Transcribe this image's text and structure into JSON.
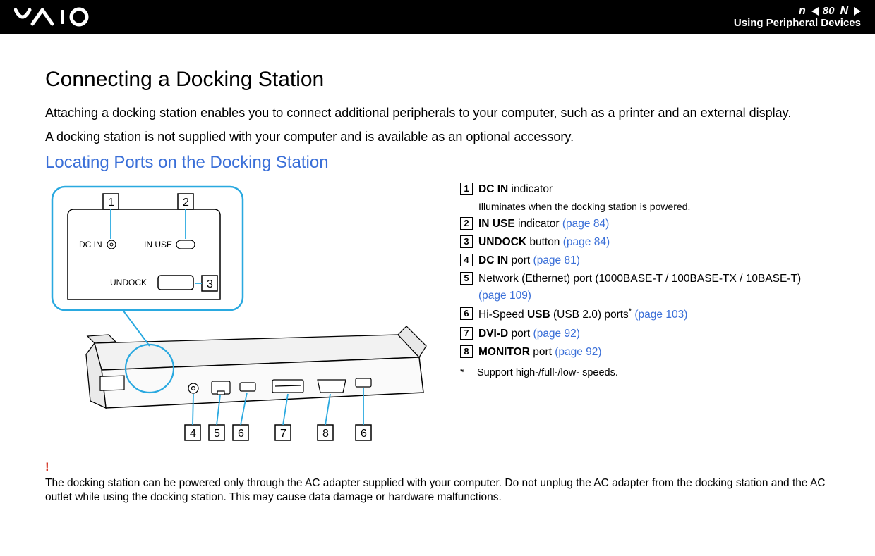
{
  "header": {
    "page_number": "80",
    "n_label": "n",
    "N_label": "N",
    "section": "Using Peripheral Devices"
  },
  "title": "Connecting a Docking Station",
  "intro": {
    "p1": "Attaching a docking station enables you to connect additional peripherals to your computer, such as a printer and an external display.",
    "p2": "A docking station is not supplied with your computer and is available as an optional accessory."
  },
  "subtitle": "Locating Ports on the Docking Station",
  "diagram_labels": {
    "dc_in": "DC IN",
    "in_use": "IN USE",
    "undock": "UNDOCK",
    "c1": "1",
    "c2": "2",
    "c3": "3",
    "c4": "4",
    "c5": "5",
    "c6": "6",
    "c7": "7",
    "c8": "8",
    "c6b": "6"
  },
  "legend": {
    "i1": {
      "num": "1",
      "bold": "DC IN",
      "after": " indicator"
    },
    "i1sub": "Illuminates when the docking station is powered.",
    "i2": {
      "num": "2",
      "bold": "IN USE",
      "after": " indicator ",
      "link": "(page 84)"
    },
    "i3": {
      "num": "3",
      "bold": "UNDOCK",
      "after": " button ",
      "link": "(page 84)"
    },
    "i4": {
      "num": "4",
      "bold": "DC IN",
      "after": " port ",
      "link": "(page 81)"
    },
    "i5": {
      "num": "5",
      "text": "Network (Ethernet) port (1000BASE-T / 100BASE-TX / 10BASE-T) ",
      "link": "(page 109)"
    },
    "i6": {
      "num": "6",
      "pre": "Hi-Speed ",
      "bold": "USB",
      "after": " (USB 2.0) ports",
      "sup": "*",
      "space": " ",
      "link": "(page 103)"
    },
    "i7": {
      "num": "7",
      "bold": "DVI-D",
      "after": " port ",
      "link": "(page 92)"
    },
    "i8": {
      "num": "8",
      "bold": "MONITOR",
      "after": " port ",
      "link": "(page 92)"
    },
    "footnote_mark": "*",
    "footnote_text": "Support high-/full-/low- speeds."
  },
  "warning": {
    "mark": "!",
    "text": "The docking station can be powered only through the AC adapter supplied with your computer. Do not unplug the AC adapter from the docking station and the AC outlet while using the docking station. This may cause data damage or hardware malfunctions."
  }
}
